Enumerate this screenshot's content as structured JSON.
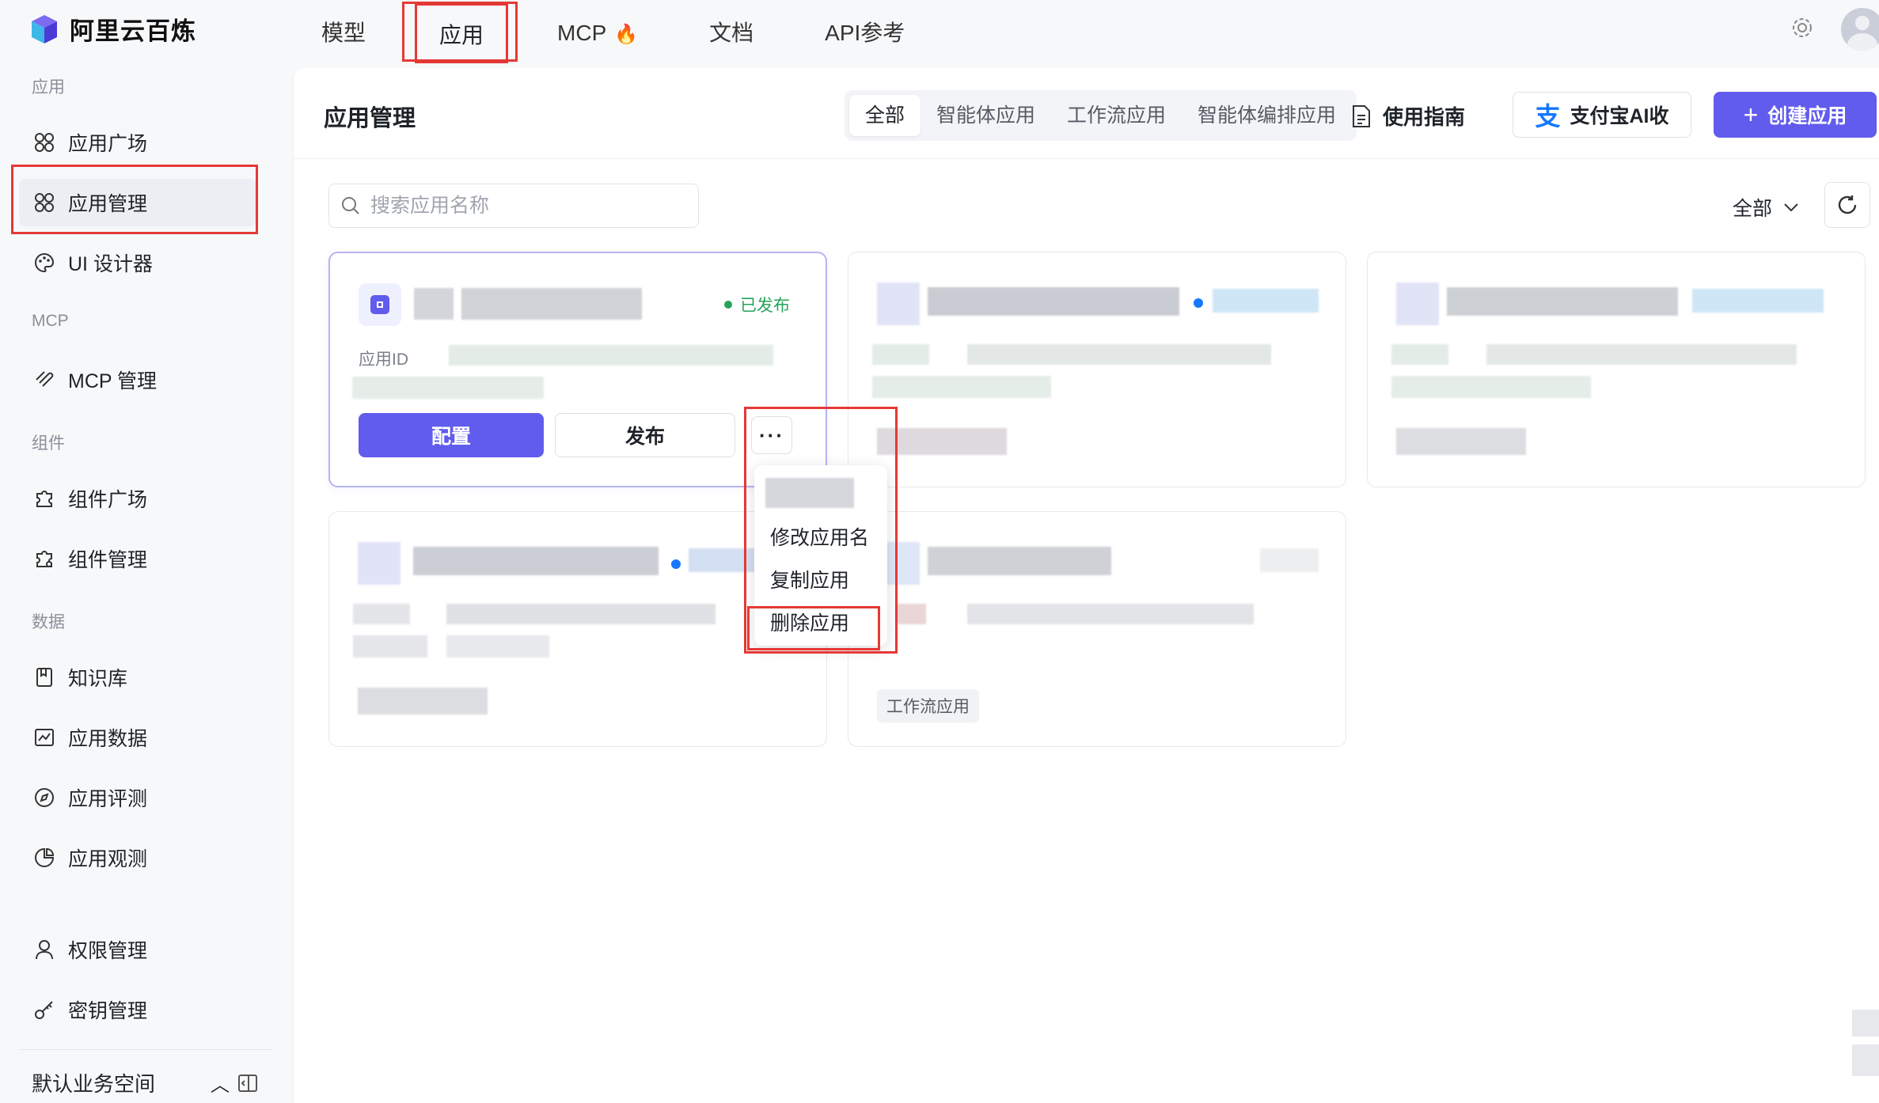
{
  "brand": {
    "name": "阿里云百炼"
  },
  "topnav": {
    "items": [
      "模型",
      "应用",
      "MCP",
      "文档",
      "API参考"
    ],
    "active": "应用"
  },
  "sidebar": {
    "sections": {
      "app": "应用",
      "mcp": "MCP",
      "component": "组件",
      "data": "数据"
    },
    "items": {
      "app_plaza": "应用广场",
      "app_manage": "应用管理",
      "ui_designer": "UI 设计器",
      "mcp_manage": "MCP 管理",
      "comp_plaza": "组件广场",
      "comp_manage": "组件管理",
      "knowledge": "知识库",
      "app_data": "应用数据",
      "app_eval": "应用评测",
      "app_observe": "应用观测",
      "permission": "权限管理",
      "key_manage": "密钥管理"
    },
    "workspace": "默认业务空间"
  },
  "main": {
    "title": "应用管理",
    "tabs": [
      "全部",
      "智能体应用",
      "工作流应用",
      "智能体编排应用"
    ],
    "active_tab": "全部",
    "guide": "使用指南",
    "alipay_button": "支付宝AI收",
    "create_button": "创建应用",
    "search_placeholder": "搜索应用名称",
    "filter_value": "全部"
  },
  "cards": {
    "first": {
      "status": "已发布",
      "app_id_label": "应用ID",
      "config_button": "配置",
      "publish_button": "发布",
      "more_button": "···"
    },
    "fifth_tag": "工作流应用"
  },
  "context_menu": {
    "items": [
      "修改应用名",
      "复制应用",
      "删除应用"
    ]
  },
  "colors": {
    "primary": "#615ced",
    "highlight_box": "#e53935",
    "published": "#27a35a"
  }
}
